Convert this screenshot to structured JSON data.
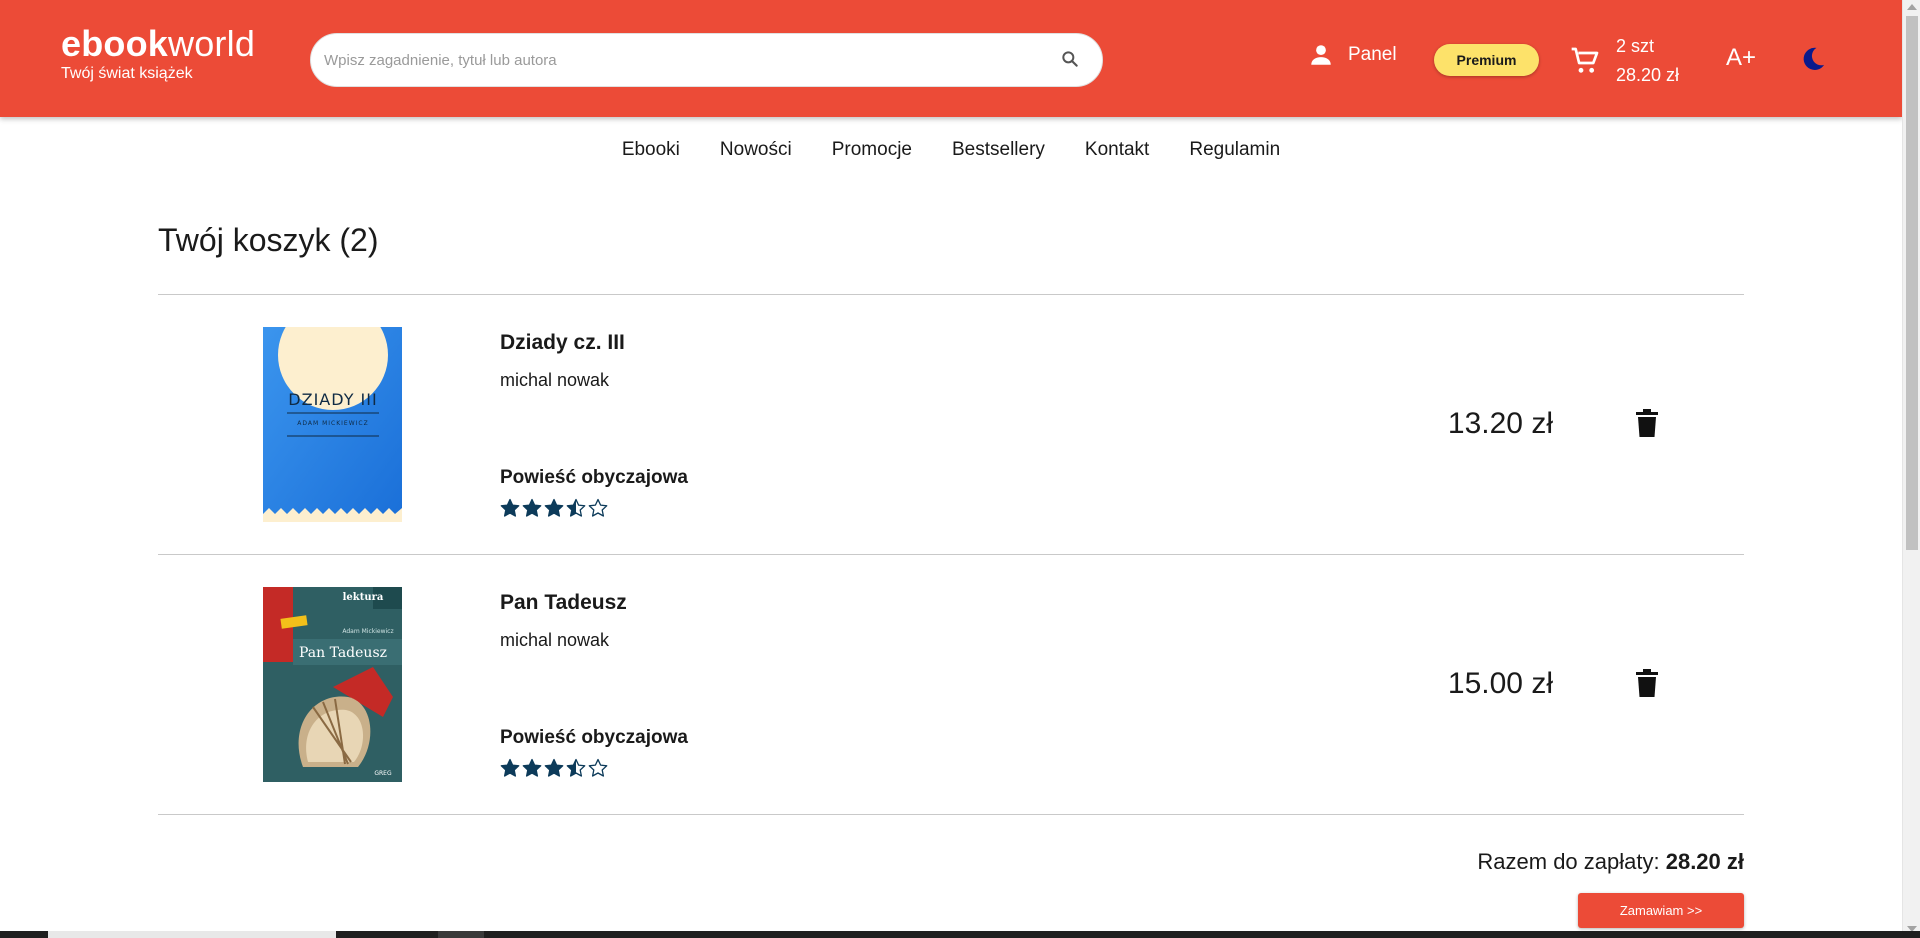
{
  "header": {
    "logo_bold": "ebook",
    "logo_light": "world",
    "tagline": "Twój świat książek",
    "search_placeholder": "Wpisz zagadnienie, tytuł lub autora",
    "panel_label": "Panel",
    "premium_label": "Premium",
    "cart_count": "2 szt",
    "cart_total": "28.20 zł",
    "font_size_label": "A+",
    "icons": {
      "search": "search-icon",
      "user": "user-icon",
      "cart": "cart-icon",
      "theme": "moon-icon"
    }
  },
  "nav": {
    "items": [
      {
        "label": "Ebooki"
      },
      {
        "label": "Nowości"
      },
      {
        "label": "Promocje"
      },
      {
        "label": "Bestsellery"
      },
      {
        "label": "Kontakt"
      },
      {
        "label": "Regulamin"
      }
    ]
  },
  "cart": {
    "title": "Twój koszyk (2)",
    "items": [
      {
        "title": "Dziady cz. III",
        "author": "michal nowak",
        "genre": "Powieść obyczajowa",
        "price": "13.20 zł",
        "rating": 3.5,
        "cover": {
          "title": "DZIADY III",
          "subtitle": "ADAM MICKIEWICZ",
          "colors": {
            "bg": "#2e8ae6",
            "moon": "#fdefcf"
          }
        }
      },
      {
        "title": "Pan Tadeusz",
        "author": "michal nowak",
        "genre": "Powieść obyczajowa",
        "price": "15.00 zł",
        "rating": 3.5,
        "cover": {
          "title": "Pan Tadeusz",
          "subtitle": "Adam Mickiewicz",
          "top": "lektura",
          "colors": {
            "bg": "#2f5f63",
            "accent": "#c42a26"
          }
        }
      }
    ],
    "total_label": "Razem do zapłaty:",
    "total_value": "28.20 zł",
    "order_label": "Zamawiam >>"
  },
  "colors": {
    "brand": "#ec4b37",
    "premium": "#fde26a",
    "star": "#0d3b5a",
    "moon": "#0a1a8c"
  }
}
